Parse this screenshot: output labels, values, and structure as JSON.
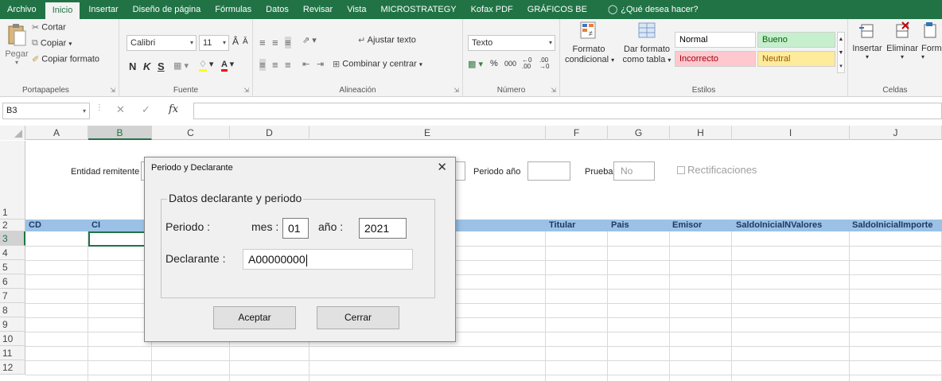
{
  "menu": {
    "items": [
      "Archivo",
      "Inicio",
      "Insertar",
      "Diseño de página",
      "Fórmulas",
      "Datos",
      "Revisar",
      "Vista",
      "MICROSTRATEGY",
      "Kofax PDF",
      "GRÁFICOS BE"
    ],
    "active_index": 1,
    "tell_me": "¿Qué desea hacer?"
  },
  "ribbon": {
    "clipboard": {
      "paste": "Pegar",
      "cut": "Cortar",
      "copy": "Copiar",
      "format_painter": "Copiar formato",
      "label": "Portapapeles"
    },
    "font": {
      "name": "Calibri",
      "size": "11",
      "bold": "N",
      "italic": "K",
      "underline": "S",
      "label": "Fuente"
    },
    "alignment": {
      "wrap": "Ajustar texto",
      "merge": "Combinar y centrar",
      "label": "Alineación"
    },
    "number": {
      "format": "Texto",
      "percent": "%",
      "thousands": "000",
      "label": "Número"
    },
    "styles": {
      "conditional": "Formato condicional",
      "conditional_a": "Formato",
      "conditional_b": "condicional",
      "table_a": "Dar formato",
      "table_b": "como tabla",
      "cells": [
        {
          "text": "Normal",
          "bg": "#ffffff",
          "fg": "#000000"
        },
        {
          "text": "Bueno",
          "bg": "#c6efce",
          "fg": "#006100"
        },
        {
          "text": "Incorrecto",
          "bg": "#ffc7ce",
          "fg": "#9c0006"
        },
        {
          "text": "Neutral",
          "bg": "#ffeb9c",
          "fg": "#9c5700"
        }
      ],
      "label": "Estilos"
    },
    "cells": {
      "insert": "Insertar",
      "delete": "Eliminar",
      "format": "Form",
      "label": "Celdas"
    }
  },
  "formula_bar": {
    "name_box": "B3",
    "fx": "fx"
  },
  "grid": {
    "columns": [
      "A",
      "B",
      "C",
      "D",
      "E",
      "F",
      "G",
      "H",
      "I",
      "J"
    ],
    "selected_column": "B",
    "rows": [
      "1",
      "2",
      "3",
      "4",
      "5",
      "6",
      "7",
      "8",
      "9",
      "10",
      "11",
      "12"
    ],
    "selected_row": "3",
    "form_labels": {
      "entidad": "Entidad remitente",
      "periodo_anio": "Periodo año",
      "pruebas": "Pruebas",
      "pruebas_value": "No",
      "rectificaciones": "Rectificaciones"
    },
    "headers": {
      "a": "CD",
      "b": "CI",
      "f": "Titular",
      "g": "Pais",
      "h": "Emisor",
      "i": "SaldoInicialNValores",
      "j": "SaldoInicialImporte"
    }
  },
  "dialog": {
    "title": "Periodo y  Declarante",
    "group_label": "Datos declarante y periodo",
    "periodo_label": "Periodo :",
    "mes_label": "mes :",
    "mes_value": "01",
    "anio_label": "año :",
    "anio_value": "2021",
    "declarante_label": "Declarante :",
    "declarante_value": "A00000000",
    "ok_button": "Aceptar",
    "close_button": "Cerrar"
  }
}
